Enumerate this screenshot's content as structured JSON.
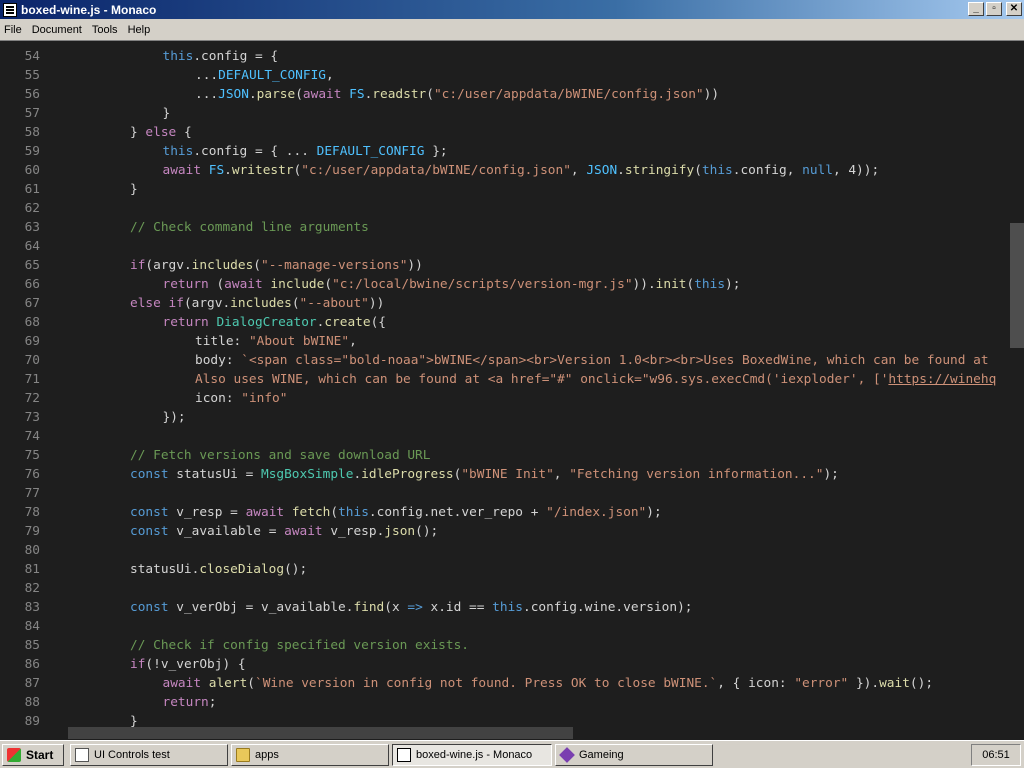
{
  "window": {
    "title": "boxed-wine.js - Monaco",
    "controls": {
      "minimize": "_",
      "maximize": "▫",
      "close": "✕"
    }
  },
  "menubar": {
    "items": [
      "File",
      "Document",
      "Tools",
      "Help"
    ]
  },
  "editor": {
    "lines": [
      {
        "n": "54",
        "i": 1,
        "t": [
          [
            "kw",
            "this"
          ],
          [
            "",
            "."
          ],
          [
            "",
            "config = {"
          ]
        ]
      },
      {
        "n": "55",
        "i": 2,
        "t": [
          [
            "",
            "..."
          ],
          [
            "cst",
            "DEFAULT_CONFIG"
          ],
          [
            "",
            ","
          ]
        ]
      },
      {
        "n": "56",
        "i": 2,
        "t": [
          [
            "",
            "..."
          ],
          [
            "cst",
            "JSON"
          ],
          [
            "",
            "."
          ],
          [
            "fn",
            "parse"
          ],
          [
            "",
            "("
          ],
          [
            "ctl",
            "await"
          ],
          [
            "",
            ""
          ],
          [
            "cst",
            " FS"
          ],
          [
            "",
            "."
          ],
          [
            "fn",
            "readstr"
          ],
          [
            "",
            "("
          ],
          [
            "str",
            "\"c:/user/appdata/bWINE/config.json\""
          ],
          [
            "",
            "))"
          ]
        ]
      },
      {
        "n": "57",
        "i": 1,
        "t": [
          [
            "",
            "}"
          ]
        ]
      },
      {
        "n": "58",
        "i": 0,
        "t": [
          [
            "",
            "} "
          ],
          [
            "ctl",
            "else"
          ],
          [
            "",
            " {"
          ]
        ]
      },
      {
        "n": "59",
        "i": 1,
        "t": [
          [
            "kw",
            "this"
          ],
          [
            "",
            ".config = { ... "
          ],
          [
            "cst",
            "DEFAULT_CONFIG"
          ],
          [
            "",
            " };"
          ]
        ]
      },
      {
        "n": "60",
        "i": 1,
        "t": [
          [
            "ctl",
            "await"
          ],
          [
            "",
            " "
          ],
          [
            "cst",
            "FS"
          ],
          [
            "",
            "."
          ],
          [
            "fn",
            "writestr"
          ],
          [
            "",
            "("
          ],
          [
            "str",
            "\"c:/user/appdata/bWINE/config.json\""
          ],
          [
            "",
            ", "
          ],
          [
            "cst",
            "JSON"
          ],
          [
            "",
            "."
          ],
          [
            "fn",
            "stringify"
          ],
          [
            "",
            "("
          ],
          [
            "kw",
            "this"
          ],
          [
            "",
            ".config, "
          ],
          [
            "kw",
            "null"
          ],
          [
            "",
            ", 4));"
          ]
        ]
      },
      {
        "n": "61",
        "i": 0,
        "t": [
          [
            "",
            "}"
          ]
        ]
      },
      {
        "n": "62",
        "i": 0,
        "t": []
      },
      {
        "n": "63",
        "i": 0,
        "t": [
          [
            "cm",
            "// Check command line arguments"
          ]
        ]
      },
      {
        "n": "64",
        "i": 0,
        "t": []
      },
      {
        "n": "65",
        "i": 0,
        "t": [
          [
            "ctl",
            "if"
          ],
          [
            "",
            "(argv."
          ],
          [
            "fn",
            "includes"
          ],
          [
            "",
            "("
          ],
          [
            "str",
            "\"--manage-versions\""
          ],
          [
            "",
            "))"
          ]
        ]
      },
      {
        "n": "66",
        "i": 1,
        "t": [
          [
            "ctl",
            "return"
          ],
          [
            "",
            " ("
          ],
          [
            "ctl",
            "await"
          ],
          [
            "",
            " "
          ],
          [
            "fn",
            "include"
          ],
          [
            "",
            "("
          ],
          [
            "str",
            "\"c:/local/bwine/scripts/version-mgr.js\""
          ],
          [
            "",
            "))."
          ],
          [
            "fn",
            "init"
          ],
          [
            "",
            "("
          ],
          [
            "kw",
            "this"
          ],
          [
            "",
            ");"
          ]
        ]
      },
      {
        "n": "67",
        "i": 0,
        "t": [
          [
            "ctl",
            "else if"
          ],
          [
            "",
            "(argv."
          ],
          [
            "fn",
            "includes"
          ],
          [
            "",
            "("
          ],
          [
            "str",
            "\"--about\""
          ],
          [
            "",
            "))"
          ]
        ]
      },
      {
        "n": "68",
        "i": 1,
        "t": [
          [
            "ctl",
            "return"
          ],
          [
            "",
            " "
          ],
          [
            "tp",
            "DialogCreator"
          ],
          [
            "",
            "."
          ],
          [
            "fn",
            "create"
          ],
          [
            "",
            "({"
          ]
        ]
      },
      {
        "n": "69",
        "i": 2,
        "t": [
          [
            "",
            "title: "
          ],
          [
            "str",
            "\"About bWINE\""
          ],
          [
            "",
            ","
          ]
        ]
      },
      {
        "n": "70",
        "i": 2,
        "t": [
          [
            "",
            "body: "
          ],
          [
            "str",
            "`<span class=\"bold-noaa\">bWINE</span><br>Version 1.0<br><br>Uses BoxedWine, which can be found at"
          ]
        ]
      },
      {
        "n": "71",
        "i": 2,
        "t": [
          [
            "str",
            "Also uses WINE, which can be found at <a href=\"#\" onclick=\"w96.sys.execCmd('iexploder', ['"
          ],
          [
            "str lnk",
            "https://winehq"
          ]
        ]
      },
      {
        "n": "72",
        "i": 2,
        "t": [
          [
            "",
            "icon: "
          ],
          [
            "str",
            "\"info\""
          ]
        ]
      },
      {
        "n": "73",
        "i": 1,
        "t": [
          [
            "",
            "});"
          ]
        ]
      },
      {
        "n": "74",
        "i": 0,
        "t": []
      },
      {
        "n": "75",
        "i": 0,
        "t": [
          [
            "cm",
            "// Fetch versions and save download URL"
          ]
        ]
      },
      {
        "n": "76",
        "i": 0,
        "t": [
          [
            "kw",
            "const"
          ],
          [
            "",
            " statusUi = "
          ],
          [
            "tp",
            "MsgBoxSimple"
          ],
          [
            "",
            "."
          ],
          [
            "fn",
            "idleProgress"
          ],
          [
            "",
            "("
          ],
          [
            "str",
            "\"bWINE Init\""
          ],
          [
            "",
            ", "
          ],
          [
            "str",
            "\"Fetching version information...\""
          ],
          [
            "",
            ");"
          ]
        ]
      },
      {
        "n": "77",
        "i": 0,
        "t": []
      },
      {
        "n": "78",
        "i": 0,
        "t": [
          [
            "kw",
            "const"
          ],
          [
            "",
            " v_resp = "
          ],
          [
            "ctl",
            "await"
          ],
          [
            "",
            " "
          ],
          [
            "fn",
            "fetch"
          ],
          [
            "",
            "("
          ],
          [
            "kw",
            "this"
          ],
          [
            "",
            ".config.net.ver_repo + "
          ],
          [
            "str",
            "\"/index.json\""
          ],
          [
            "",
            ");"
          ]
        ]
      },
      {
        "n": "79",
        "i": 0,
        "t": [
          [
            "kw",
            "const"
          ],
          [
            "",
            " v_available = "
          ],
          [
            "ctl",
            "await"
          ],
          [
            "",
            " v_resp."
          ],
          [
            "fn",
            "json"
          ],
          [
            "",
            "();"
          ]
        ]
      },
      {
        "n": "80",
        "i": 0,
        "t": []
      },
      {
        "n": "81",
        "i": 0,
        "t": [
          [
            "",
            "statusUi."
          ],
          [
            "fn",
            "closeDialog"
          ],
          [
            "",
            "();"
          ]
        ]
      },
      {
        "n": "82",
        "i": 0,
        "t": []
      },
      {
        "n": "83",
        "i": 0,
        "t": [
          [
            "kw",
            "const"
          ],
          [
            "",
            " v_verObj = v_available."
          ],
          [
            "fn",
            "find"
          ],
          [
            "",
            "(x "
          ],
          [
            "kw",
            "=>"
          ],
          [
            "",
            " x.id == "
          ],
          [
            "kw",
            "this"
          ],
          [
            "",
            ".config.wine.version);"
          ]
        ]
      },
      {
        "n": "84",
        "i": 0,
        "t": []
      },
      {
        "n": "85",
        "i": 0,
        "t": [
          [
            "cm",
            "// Check if config specified version exists."
          ]
        ]
      },
      {
        "n": "86",
        "i": 0,
        "t": [
          [
            "ctl",
            "if"
          ],
          [
            "",
            "(!v_verObj) {"
          ]
        ]
      },
      {
        "n": "87",
        "i": 1,
        "t": [
          [
            "ctl",
            "await"
          ],
          [
            "",
            " "
          ],
          [
            "fn",
            "alert"
          ],
          [
            "",
            "("
          ],
          [
            "str",
            "`Wine version in config not found. Press OK to close bWINE.`"
          ],
          [
            "",
            ", { icon: "
          ],
          [
            "str",
            "\"error\""
          ],
          [
            "",
            " })."
          ],
          [
            "fn",
            "wait"
          ],
          [
            "",
            "();"
          ]
        ]
      },
      {
        "n": "88",
        "i": 1,
        "t": [
          [
            "ctl",
            "return"
          ],
          [
            "",
            ";"
          ]
        ]
      },
      {
        "n": "89",
        "i": 0,
        "t": [
          [
            "",
            "}"
          ]
        ]
      }
    ]
  },
  "taskbar": {
    "start_label": "Start",
    "items": [
      {
        "label": "UI Controls test",
        "icon": "document-icon"
      },
      {
        "label": "apps",
        "icon": "folder-icon"
      },
      {
        "label": "boxed-wine.js - Monaco",
        "icon": "app-icon"
      },
      {
        "label": "Gameing",
        "icon": "gem-icon"
      }
    ],
    "clock": "06:51"
  }
}
